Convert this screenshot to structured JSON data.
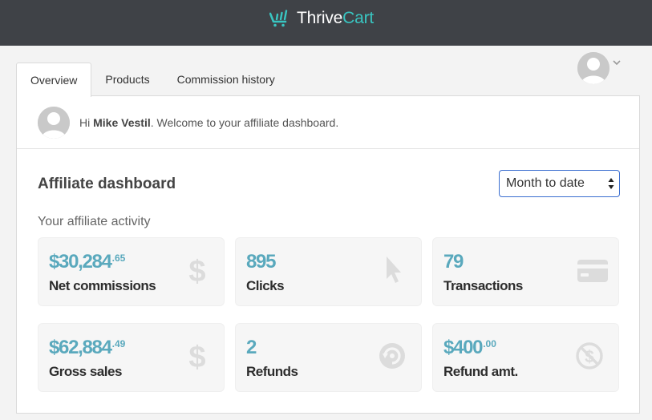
{
  "header": {
    "brand_part1": "Thrive",
    "brand_part2": "Cart",
    "logo_icon": "thrivecart-cart-icon"
  },
  "tabs": [
    {
      "label": "Overview",
      "active": true
    },
    {
      "label": "Products",
      "active": false
    },
    {
      "label": "Commission history",
      "active": false
    }
  ],
  "user_menu": {
    "avatar_icon": "user-avatar-icon",
    "chevron_icon": "chevron-down-icon"
  },
  "welcome": {
    "greeting": "Hi",
    "name": "Mike Vestil",
    "message": ". Welcome to your affiliate dashboard."
  },
  "dashboard": {
    "title": "Affiliate dashboard",
    "range_selected": "Month to date",
    "activity_label": "Your affiliate activity"
  },
  "stats": [
    {
      "value_main": "$30,284",
      "value_cents": ".65",
      "label": "Net commissions",
      "icon": "dollar-icon"
    },
    {
      "value_main": "895",
      "value_cents": "",
      "label": "Clicks",
      "icon": "cursor-icon"
    },
    {
      "value_main": "79",
      "value_cents": "",
      "label": "Transactions",
      "icon": "credit-card-icon"
    },
    {
      "value_main": "$62,884",
      "value_cents": ".49",
      "label": "Gross sales",
      "icon": "dollar-icon"
    },
    {
      "value_main": "2",
      "value_cents": "",
      "label": "Refunds",
      "icon": "refund-icon"
    },
    {
      "value_main": "$400",
      "value_cents": ".00",
      "label": "Refund amt.",
      "icon": "no-dollar-icon"
    }
  ],
  "colors": {
    "header_bg": "#3f4247",
    "accent": "#39c5c1",
    "stat_value": "#5aa9bd",
    "select_border": "#3b6ed0"
  }
}
